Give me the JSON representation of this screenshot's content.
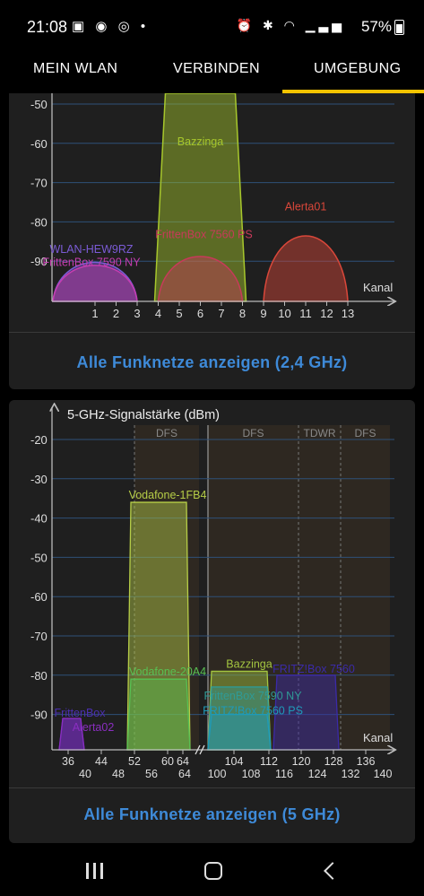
{
  "status": {
    "time": "21:08",
    "battery": "57%"
  },
  "tabs": [
    "MEIN WLAN",
    "VERBINDEN",
    "UMGEBUNG"
  ],
  "colors": {
    "accent": "#f5c400",
    "link": "#3e8ad8",
    "card": "#1f1f1f"
  },
  "card24": {
    "link": "Alle Funknetze anzeigen (2,4 GHz)",
    "chart_data": {
      "type": "area",
      "xlabel": "Kanal",
      "ylim": [
        -100,
        -47
      ],
      "y_ticks": [
        -50,
        -60,
        -70,
        -80,
        -90
      ],
      "x_ticks": [
        1,
        2,
        3,
        4,
        5,
        6,
        7,
        8,
        9,
        10,
        11,
        12,
        13
      ],
      "networks": [
        {
          "name": "WLAN-HEW9RZ",
          "channel": 1,
          "signal": -87,
          "shape": "curve",
          "color": "#7b5bd6"
        },
        {
          "name": "FrittenBox 7590 NY",
          "channel": 1,
          "signal": -88,
          "shape": "curve",
          "color": "#c53db0"
        },
        {
          "name": "Bazzinga",
          "channel": 6,
          "signal": -45,
          "shape": "trapezoid",
          "color": "#a7c72c"
        },
        {
          "name": "FrittenBox 7560 PS",
          "channel": 6,
          "signal": -85,
          "shape": "curve",
          "color": "#c83a5a"
        },
        {
          "name": "Alerta01",
          "channel": 11,
          "signal": -78,
          "shape": "curve",
          "color": "#d9473a"
        }
      ]
    }
  },
  "card5": {
    "title": "5-GHz-Signalstärke (dBm)",
    "link": "Alle Funknetze anzeigen (5 GHz)",
    "chart_data": {
      "type": "area",
      "xlabel": "Kanal",
      "ylim": [
        -100,
        -18
      ],
      "y_ticks": [
        -20,
        -30,
        -40,
        -50,
        -60,
        -70,
        -80,
        -90
      ],
      "x_ticks_upper": [
        36,
        44,
        52,
        60,
        64,
        104,
        112,
        120,
        128,
        136
      ],
      "x_ticks_lower": [
        40,
        48,
        56,
        64,
        100,
        108,
        116,
        124,
        132,
        140
      ],
      "bands": [
        "DFS",
        "DFS",
        "TDWR",
        "DFS"
      ],
      "networks": [
        {
          "name": "FrittenBox",
          "from": 36,
          "to": 48,
          "signal": -91,
          "color": "#4b2fb0"
        },
        {
          "name": "Alerta02",
          "from": 36,
          "to": 48,
          "signal": -91,
          "color": "#8a2ec0"
        },
        {
          "name": "Vodafone-1FB4",
          "from": 52,
          "to": 64,
          "signal": -36,
          "color": "#b6cd47"
        },
        {
          "name": "Vodafone-20A4",
          "from": 52,
          "to": 64,
          "signal": -81,
          "color": "#58c053"
        },
        {
          "name": "Bazzinga",
          "from": 100,
          "to": 112,
          "signal": -79,
          "color": "#a4c640"
        },
        {
          "name": "FrittenBox 7590 NY",
          "from": 100,
          "to": 112,
          "signal": -83,
          "color": "#2f9a96"
        },
        {
          "name": "FRITZ!Box 7560 PS",
          "from": 100,
          "to": 112,
          "signal": -90,
          "color": "#1e9ab9"
        },
        {
          "name": "FRITZ!Box 7560",
          "from": 116,
          "to": 128,
          "signal": -80,
          "color": "#3b2aa8"
        }
      ]
    }
  }
}
